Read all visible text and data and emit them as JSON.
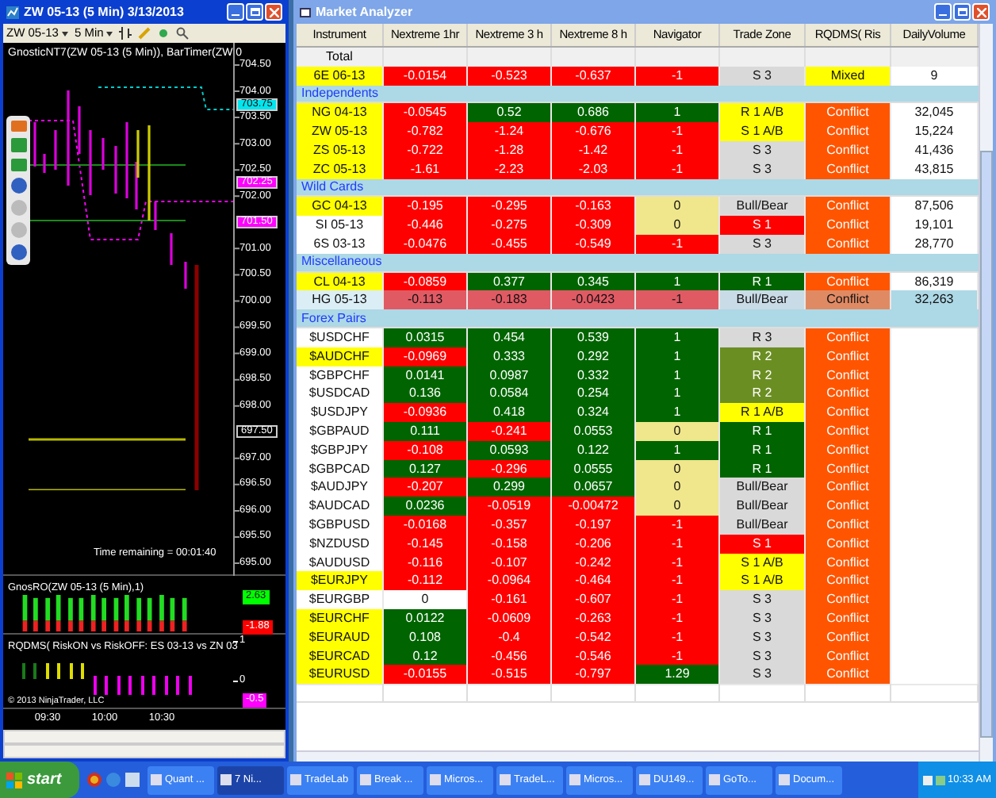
{
  "chart_window": {
    "title": "ZW 05-13 (5 Min)  3/13/2013",
    "toolbar": {
      "instrument": "ZW 05-13",
      "interval": "5 Min"
    },
    "indicator_label": "GnosticNT7(ZW 05-13 (5 Min)), BarTimer(ZW 0",
    "price_axis": [
      "704.50",
      "704.00",
      "703.50",
      "703.00",
      "702.50",
      "702.00",
      "701.00",
      "700.50",
      "700.00",
      "699.50",
      "699.00",
      "698.50",
      "698.00",
      "697.00",
      "696.50",
      "696.00",
      "695.50",
      "695.00"
    ],
    "price_markers": [
      {
        "text": "703.75",
        "color": "#00e5ee"
      },
      {
        "text": "702.25",
        "color": "#ff00ff"
      },
      {
        "text": "701.50",
        "color": "#ff00ff"
      },
      {
        "text": "697.50",
        "color": "#000000"
      }
    ],
    "time_remaining": "Time remaining = 00:01:40",
    "panel_2": {
      "label": "GnosRO(ZW 05-13 (5 Min),1)",
      "markers": [
        {
          "text": "2.63",
          "color": "#00ff00"
        },
        {
          "text": "-1.88",
          "color": "#ff0000"
        }
      ]
    },
    "panel_3": {
      "label": "RQDMS( RiskON vs RiskOFF: ES 03-13 vs ZN 03",
      "axis": [
        "1",
        "0"
      ],
      "marker": "-0.5"
    },
    "copyright": "© 2013 NinjaTrader, LLC",
    "time_axis": [
      "09:30",
      "10:00",
      "10:30"
    ]
  },
  "market_analyzer": {
    "title": "Market Analyzer",
    "columns": [
      "Instrument",
      "Nextreme 1hr",
      "Nextreme 3 h",
      "Nextreme 8 h",
      "Navigator",
      "Trade Zone",
      "RQDMS( Ris",
      "DailyVolume"
    ],
    "rows": [
      {
        "kind": "total",
        "label": "Total"
      },
      {
        "kind": "item",
        "instrument": {
          "text": "6E 06-13",
          "color": "#ffff00"
        },
        "cells": [
          {
            "text": "-0.0154",
            "color": "#ff0000"
          },
          {
            "text": "-0.523",
            "color": "#ff0000"
          },
          {
            "text": "-0.637",
            "color": "#ff0000"
          },
          {
            "text": "-1",
            "color": "#ff0000"
          },
          {
            "text": "S 3",
            "color": "#d9d9d9"
          },
          {
            "text": "Mixed",
            "color": "#ffff00"
          },
          {
            "text": "9",
            "color": "#ffffff"
          }
        ]
      },
      {
        "kind": "group",
        "label": "Independents"
      },
      {
        "kind": "item",
        "instrument": {
          "text": "NG 04-13",
          "color": "#ffff00"
        },
        "cells": [
          {
            "text": "-0.0545",
            "color": "#ff0000"
          },
          {
            "text": "0.52",
            "color": "#006400"
          },
          {
            "text": "0.686",
            "color": "#006400"
          },
          {
            "text": "1",
            "color": "#006400"
          },
          {
            "text": "R 1 A/B",
            "color": "#ffff00"
          },
          {
            "text": "Conflict",
            "color": "#ff5500"
          },
          {
            "text": "32,045",
            "color": "#ffffff"
          }
        ]
      },
      {
        "kind": "item",
        "instrument": {
          "text": "ZW 05-13",
          "color": "#ffff00"
        },
        "cells": [
          {
            "text": "-0.782",
            "color": "#ff0000"
          },
          {
            "text": "-1.24",
            "color": "#ff0000"
          },
          {
            "text": "-0.676",
            "color": "#ff0000"
          },
          {
            "text": "-1",
            "color": "#ff0000"
          },
          {
            "text": "S 1 A/B",
            "color": "#ffff00"
          },
          {
            "text": "Conflict",
            "color": "#ff5500"
          },
          {
            "text": "15,224",
            "color": "#ffffff"
          }
        ]
      },
      {
        "kind": "item",
        "instrument": {
          "text": "ZS 05-13",
          "color": "#ffff00"
        },
        "cells": [
          {
            "text": "-0.722",
            "color": "#ff0000"
          },
          {
            "text": "-1.28",
            "color": "#ff0000"
          },
          {
            "text": "-1.42",
            "color": "#ff0000"
          },
          {
            "text": "-1",
            "color": "#ff0000"
          },
          {
            "text": "S 3",
            "color": "#d9d9d9"
          },
          {
            "text": "Conflict",
            "color": "#ff5500"
          },
          {
            "text": "41,436",
            "color": "#ffffff"
          }
        ]
      },
      {
        "kind": "item",
        "instrument": {
          "text": "ZC 05-13",
          "color": "#ffff00"
        },
        "cells": [
          {
            "text": "-1.61",
            "color": "#ff0000"
          },
          {
            "text": "-2.23",
            "color": "#ff0000"
          },
          {
            "text": "-2.03",
            "color": "#ff0000"
          },
          {
            "text": "-1",
            "color": "#ff0000"
          },
          {
            "text": "S 3",
            "color": "#d9d9d9"
          },
          {
            "text": "Conflict",
            "color": "#ff5500"
          },
          {
            "text": "43,815",
            "color": "#ffffff"
          }
        ]
      },
      {
        "kind": "group",
        "label": "Wild Cards"
      },
      {
        "kind": "item",
        "instrument": {
          "text": "GC 04-13",
          "color": "#ffff00"
        },
        "cells": [
          {
            "text": "-0.195",
            "color": "#ff0000"
          },
          {
            "text": "-0.295",
            "color": "#ff0000"
          },
          {
            "text": "-0.163",
            "color": "#ff0000"
          },
          {
            "text": "0",
            "color": "#f0e68c"
          },
          {
            "text": "Bull/Bear",
            "color": "#d9d9d9"
          },
          {
            "text": "Conflict",
            "color": "#ff5500"
          },
          {
            "text": "87,506",
            "color": "#ffffff"
          }
        ]
      },
      {
        "kind": "item",
        "instrument": {
          "text": "SI 05-13",
          "color": "#ffffff"
        },
        "cells": [
          {
            "text": "-0.446",
            "color": "#ff0000"
          },
          {
            "text": "-0.275",
            "color": "#ff0000"
          },
          {
            "text": "-0.309",
            "color": "#ff0000"
          },
          {
            "text": "0",
            "color": "#f0e68c"
          },
          {
            "text": "S 1",
            "color": "#ff0000"
          },
          {
            "text": "Conflict",
            "color": "#ff5500"
          },
          {
            "text": "19,101",
            "color": "#ffffff"
          }
        ]
      },
      {
        "kind": "item",
        "instrument": {
          "text": "6S 03-13",
          "color": "#ffffff"
        },
        "cells": [
          {
            "text": "-0.0476",
            "color": "#ff0000"
          },
          {
            "text": "-0.455",
            "color": "#ff0000"
          },
          {
            "text": "-0.549",
            "color": "#ff0000"
          },
          {
            "text": "-1",
            "color": "#ff0000"
          },
          {
            "text": "S 3",
            "color": "#d9d9d9"
          },
          {
            "text": "Conflict",
            "color": "#ff5500"
          },
          {
            "text": "28,770",
            "color": "#ffffff"
          }
        ]
      },
      {
        "kind": "group",
        "label": "Miscellaneous"
      },
      {
        "kind": "item",
        "instrument": {
          "text": "CL 04-13",
          "color": "#ffff00"
        },
        "cells": [
          {
            "text": "-0.0859",
            "color": "#ff0000"
          },
          {
            "text": "0.377",
            "color": "#006400"
          },
          {
            "text": "0.345",
            "color": "#006400"
          },
          {
            "text": "1",
            "color": "#006400"
          },
          {
            "text": "R 1",
            "color": "#006400"
          },
          {
            "text": "Conflict",
            "color": "#ff5500"
          },
          {
            "text": "86,319",
            "color": "#ffffff"
          }
        ]
      },
      {
        "kind": "item",
        "instrument": {
          "text": "HG 05-13",
          "color": "#dbeef5"
        },
        "cells": [
          {
            "text": "-0.113",
            "color": "#e05a64"
          },
          {
            "text": "-0.183",
            "color": "#e05a64"
          },
          {
            "text": "-0.0423",
            "color": "#e05a64"
          },
          {
            "text": "-1",
            "color": "#e05a64"
          },
          {
            "text": "Bull/Bear",
            "color": "#c9dbe6"
          },
          {
            "text": "Conflict",
            "color": "#e08a64"
          },
          {
            "text": "32,263",
            "color": "#add8e6"
          }
        ]
      },
      {
        "kind": "group",
        "label": "Forex Pairs"
      },
      {
        "kind": "item",
        "instrument": {
          "text": "$USDCHF",
          "color": "#ffffff"
        },
        "cells": [
          {
            "text": "0.0315",
            "color": "#006400"
          },
          {
            "text": "0.454",
            "color": "#006400"
          },
          {
            "text": "0.539",
            "color": "#006400"
          },
          {
            "text": "1",
            "color": "#006400"
          },
          {
            "text": "R 3",
            "color": "#d9d9d9"
          },
          {
            "text": "Conflict",
            "color": "#ff5500"
          },
          {
            "color": "#ffffff"
          }
        ]
      },
      {
        "kind": "item",
        "instrument": {
          "text": "$AUDCHF",
          "color": "#ffff00"
        },
        "cells": [
          {
            "text": "-0.0969",
            "color": "#ff0000"
          },
          {
            "text": "0.333",
            "color": "#006400"
          },
          {
            "text": "0.292",
            "color": "#006400"
          },
          {
            "text": "1",
            "color": "#006400"
          },
          {
            "text": "R 2",
            "color": "#6b8e23"
          },
          {
            "text": "Conflict",
            "color": "#ff5500"
          },
          {
            "color": "#ffffff"
          }
        ]
      },
      {
        "kind": "item",
        "instrument": {
          "text": "$GBPCHF",
          "color": "#ffffff"
        },
        "cells": [
          {
            "text": "0.0141",
            "color": "#006400"
          },
          {
            "text": "0.0987",
            "color": "#006400"
          },
          {
            "text": "0.332",
            "color": "#006400"
          },
          {
            "text": "1",
            "color": "#006400"
          },
          {
            "text": "R 2",
            "color": "#6b8e23"
          },
          {
            "text": "Conflict",
            "color": "#ff5500"
          },
          {
            "color": "#ffffff"
          }
        ]
      },
      {
        "kind": "item",
        "instrument": {
          "text": "$USDCAD",
          "color": "#ffffff"
        },
        "cells": [
          {
            "text": "0.136",
            "color": "#006400"
          },
          {
            "text": "0.0584",
            "color": "#006400"
          },
          {
            "text": "0.254",
            "color": "#006400"
          },
          {
            "text": "1",
            "color": "#006400"
          },
          {
            "text": "R 2",
            "color": "#6b8e23"
          },
          {
            "text": "Conflict",
            "color": "#ff5500"
          },
          {
            "color": "#ffffff"
          }
        ]
      },
      {
        "kind": "item",
        "instrument": {
          "text": "$USDJPY",
          "color": "#ffffff"
        },
        "cells": [
          {
            "text": "-0.0936",
            "color": "#ff0000"
          },
          {
            "text": "0.418",
            "color": "#006400"
          },
          {
            "text": "0.324",
            "color": "#006400"
          },
          {
            "text": "1",
            "color": "#006400"
          },
          {
            "text": "R 1 A/B",
            "color": "#ffff00"
          },
          {
            "text": "Conflict",
            "color": "#ff5500"
          },
          {
            "color": "#ffffff"
          }
        ]
      },
      {
        "kind": "item",
        "instrument": {
          "text": "$GBPAUD",
          "color": "#ffffff"
        },
        "cells": [
          {
            "text": "0.111",
            "color": "#006400"
          },
          {
            "text": "-0.241",
            "color": "#ff0000"
          },
          {
            "text": "0.0553",
            "color": "#006400"
          },
          {
            "text": "0",
            "color": "#f0e68c"
          },
          {
            "text": "R 1",
            "color": "#006400"
          },
          {
            "text": "Conflict",
            "color": "#ff5500"
          },
          {
            "color": "#ffffff"
          }
        ]
      },
      {
        "kind": "item",
        "instrument": {
          "text": "$GBPJPY",
          "color": "#ffffff"
        },
        "cells": [
          {
            "text": "-0.108",
            "color": "#ff0000"
          },
          {
            "text": "0.0593",
            "color": "#006400"
          },
          {
            "text": "0.122",
            "color": "#006400"
          },
          {
            "text": "1",
            "color": "#006400"
          },
          {
            "text": "R 1",
            "color": "#006400"
          },
          {
            "text": "Conflict",
            "color": "#ff5500"
          },
          {
            "color": "#ffffff"
          }
        ]
      },
      {
        "kind": "item",
        "instrument": {
          "text": "$GBPCAD",
          "color": "#ffffff"
        },
        "cells": [
          {
            "text": "0.127",
            "color": "#006400"
          },
          {
            "text": "-0.296",
            "color": "#ff0000"
          },
          {
            "text": "0.0555",
            "color": "#006400"
          },
          {
            "text": "0",
            "color": "#f0e68c"
          },
          {
            "text": "R 1",
            "color": "#006400"
          },
          {
            "text": "Conflict",
            "color": "#ff5500"
          },
          {
            "color": "#ffffff"
          }
        ]
      },
      {
        "kind": "item",
        "instrument": {
          "text": "$AUDJPY",
          "color": "#ffffff"
        },
        "cells": [
          {
            "text": "-0.207",
            "color": "#ff0000"
          },
          {
            "text": "0.299",
            "color": "#006400"
          },
          {
            "text": "0.0657",
            "color": "#006400"
          },
          {
            "text": "0",
            "color": "#f0e68c"
          },
          {
            "text": "Bull/Bear",
            "color": "#d9d9d9"
          },
          {
            "text": "Conflict",
            "color": "#ff5500"
          },
          {
            "color": "#ffffff"
          }
        ]
      },
      {
        "kind": "item",
        "instrument": {
          "text": "$AUDCAD",
          "color": "#ffffff"
        },
        "cells": [
          {
            "text": "0.0236",
            "color": "#006400"
          },
          {
            "text": "-0.0519",
            "color": "#ff0000"
          },
          {
            "text": "-0.00472",
            "color": "#ff0000"
          },
          {
            "text": "0",
            "color": "#f0e68c"
          },
          {
            "text": "Bull/Bear",
            "color": "#d9d9d9"
          },
          {
            "text": "Conflict",
            "color": "#ff5500"
          },
          {
            "color": "#ffffff"
          }
        ]
      },
      {
        "kind": "item",
        "instrument": {
          "text": "$GBPUSD",
          "color": "#ffffff"
        },
        "cells": [
          {
            "text": "-0.0168",
            "color": "#ff0000"
          },
          {
            "text": "-0.357",
            "color": "#ff0000"
          },
          {
            "text": "-0.197",
            "color": "#ff0000"
          },
          {
            "text": "-1",
            "color": "#ff0000"
          },
          {
            "text": "Bull/Bear",
            "color": "#d9d9d9"
          },
          {
            "text": "Conflict",
            "color": "#ff5500"
          },
          {
            "color": "#ffffff"
          }
        ]
      },
      {
        "kind": "item",
        "instrument": {
          "text": "$NZDUSD",
          "color": "#ffffff"
        },
        "cells": [
          {
            "text": "-0.145",
            "color": "#ff0000"
          },
          {
            "text": "-0.158",
            "color": "#ff0000"
          },
          {
            "text": "-0.206",
            "color": "#ff0000"
          },
          {
            "text": "-1",
            "color": "#ff0000"
          },
          {
            "text": "S 1",
            "color": "#ff0000"
          },
          {
            "text": "Conflict",
            "color": "#ff5500"
          },
          {
            "color": "#ffffff"
          }
        ]
      },
      {
        "kind": "item",
        "instrument": {
          "text": "$AUDUSD",
          "color": "#ffffff"
        },
        "cells": [
          {
            "text": "-0.116",
            "color": "#ff0000"
          },
          {
            "text": "-0.107",
            "color": "#ff0000"
          },
          {
            "text": "-0.242",
            "color": "#ff0000"
          },
          {
            "text": "-1",
            "color": "#ff0000"
          },
          {
            "text": "S 1 A/B",
            "color": "#ffff00"
          },
          {
            "text": "Conflict",
            "color": "#ff5500"
          },
          {
            "color": "#ffffff"
          }
        ]
      },
      {
        "kind": "item",
        "instrument": {
          "text": "$EURJPY",
          "color": "#ffff00"
        },
        "cells": [
          {
            "text": "-0.112",
            "color": "#ff0000"
          },
          {
            "text": "-0.0964",
            "color": "#ff0000"
          },
          {
            "text": "-0.464",
            "color": "#ff0000"
          },
          {
            "text": "-1",
            "color": "#ff0000"
          },
          {
            "text": "S 1 A/B",
            "color": "#ffff00"
          },
          {
            "text": "Conflict",
            "color": "#ff5500"
          },
          {
            "color": "#ffffff"
          }
        ]
      },
      {
        "kind": "item",
        "instrument": {
          "text": "$EURGBP",
          "color": "#ffffff"
        },
        "cells": [
          {
            "text": "0",
            "color": "#ffffff"
          },
          {
            "text": "-0.161",
            "color": "#ff0000"
          },
          {
            "text": "-0.607",
            "color": "#ff0000"
          },
          {
            "text": "-1",
            "color": "#ff0000"
          },
          {
            "text": "S 3",
            "color": "#d9d9d9"
          },
          {
            "text": "Conflict",
            "color": "#ff5500"
          },
          {
            "color": "#ffffff"
          }
        ]
      },
      {
        "kind": "item",
        "instrument": {
          "text": "$EURCHF",
          "color": "#ffff00"
        },
        "cells": [
          {
            "text": "0.0122",
            "color": "#006400"
          },
          {
            "text": "-0.0609",
            "color": "#ff0000"
          },
          {
            "text": "-0.263",
            "color": "#ff0000"
          },
          {
            "text": "-1",
            "color": "#ff0000"
          },
          {
            "text": "S 3",
            "color": "#d9d9d9"
          },
          {
            "text": "Conflict",
            "color": "#ff5500"
          },
          {
            "color": "#ffffff"
          }
        ]
      },
      {
        "kind": "item",
        "instrument": {
          "text": "$EURAUD",
          "color": "#ffff00"
        },
        "cells": [
          {
            "text": "0.108",
            "color": "#006400"
          },
          {
            "text": "-0.4",
            "color": "#ff0000"
          },
          {
            "text": "-0.542",
            "color": "#ff0000"
          },
          {
            "text": "-1",
            "color": "#ff0000"
          },
          {
            "text": "S 3",
            "color": "#d9d9d9"
          },
          {
            "text": "Conflict",
            "color": "#ff5500"
          },
          {
            "color": "#ffffff"
          }
        ]
      },
      {
        "kind": "item",
        "instrument": {
          "text": "$EURCAD",
          "color": "#ffff00"
        },
        "cells": [
          {
            "text": "0.12",
            "color": "#006400"
          },
          {
            "text": "-0.456",
            "color": "#ff0000"
          },
          {
            "text": "-0.546",
            "color": "#ff0000"
          },
          {
            "text": "-1",
            "color": "#ff0000"
          },
          {
            "text": "S 3",
            "color": "#d9d9d9"
          },
          {
            "text": "Conflict",
            "color": "#ff5500"
          },
          {
            "color": "#ffffff"
          }
        ]
      },
      {
        "kind": "item",
        "instrument": {
          "text": "$EURUSD",
          "color": "#ffff00"
        },
        "cells": [
          {
            "text": "-0.0155",
            "color": "#ff0000"
          },
          {
            "text": "-0.515",
            "color": "#ff0000"
          },
          {
            "text": "-0.797",
            "color": "#ff0000"
          },
          {
            "text": "1.29",
            "color": "#006400"
          },
          {
            "text": "S 3",
            "color": "#d9d9d9"
          },
          {
            "text": "Conflict",
            "color": "#ff5500"
          },
          {
            "color": "#ffffff"
          }
        ]
      }
    ]
  },
  "taskbar": {
    "start": "start",
    "tasks": [
      {
        "label": "Quant ...",
        "selected": false
      },
      {
        "label": "7 Ni...",
        "selected": true
      },
      {
        "label": "TradeLab",
        "selected": false
      },
      {
        "label": "Break ...",
        "selected": false
      },
      {
        "label": "Micros...",
        "selected": false
      },
      {
        "label": "TradeL...",
        "selected": false
      },
      {
        "label": "Micros...",
        "selected": false
      },
      {
        "label": "DU149...",
        "selected": false
      },
      {
        "label": "GoTo...",
        "selected": false
      },
      {
        "label": "Docum...",
        "selected": false
      }
    ],
    "clock": "10:33 AM"
  }
}
